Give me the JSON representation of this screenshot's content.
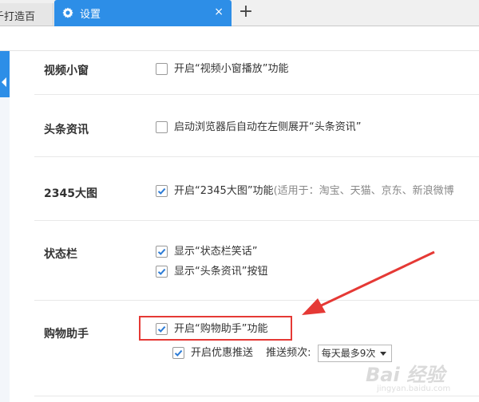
{
  "tabs": {
    "inactive_label": "千打造百",
    "active_label": "设置",
    "close_symbol": "×",
    "new_tab_symbol": "+"
  },
  "settings": {
    "video_row": {
      "title": "视频小窗",
      "option": "开启“视频小窗播放”功能",
      "checked": false
    },
    "news_row": {
      "title": "头条资讯",
      "option": "启动浏览器后自动在左侧展开“头条资讯”",
      "checked": false
    },
    "bigimg_row": {
      "title": "2345大图",
      "option": "开启“2345大图”功能",
      "note": "(适用于：淘宝、天猫、京东、新浪微博",
      "checked": true
    },
    "statusbar_row": {
      "title": "状态栏",
      "option1": "显示“状态栏笑话”",
      "option1_checked": true,
      "option2": "显示“头条资讯”按钮",
      "option2_checked": true
    },
    "shopping_row": {
      "title": "购物助手",
      "option1": "开启“购物助手”功能",
      "option1_checked": true,
      "option2": "开启优惠推送",
      "option2_checked": true,
      "frequency_label": "推送频次:",
      "frequency_value": "每天最多9次"
    }
  },
  "watermark": {
    "main": "Bai 经验",
    "url": "jingyan.baidu.com"
  },
  "colors": {
    "accent": "#2d8ee7",
    "annotation_red": "#e53935",
    "checkbox_check": "#2b7bd6"
  },
  "icons": {
    "gear": "gear-icon",
    "close": "close-icon",
    "plus": "plus-icon",
    "check": "check-icon"
  }
}
